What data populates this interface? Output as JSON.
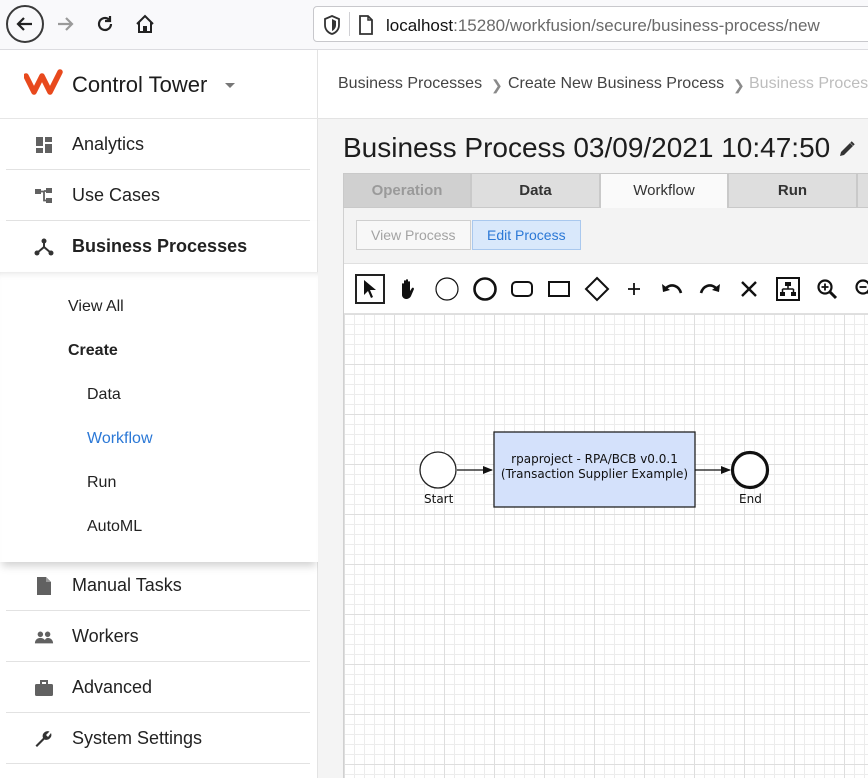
{
  "browser": {
    "url_host": "localhost",
    "url_rest": ":15280/workfusion/secure/business-process/new"
  },
  "app": {
    "name": "Control Tower",
    "accent": "#e8491d",
    "link_color": "#2b78d6"
  },
  "sidebar": {
    "items": [
      {
        "label": "Analytics",
        "icon": "dashboard-icon"
      },
      {
        "label": "Use Cases",
        "icon": "hierarchy-icon"
      },
      {
        "label": "Business Processes",
        "icon": "merge-icon",
        "active": true
      },
      {
        "label": "Manual Tasks",
        "icon": "document-icon"
      },
      {
        "label": "Workers",
        "icon": "people-icon"
      },
      {
        "label": "Advanced",
        "icon": "briefcase-icon"
      },
      {
        "label": "System Settings",
        "icon": "wrench-icon"
      }
    ],
    "submenu": {
      "view_all": "View All",
      "create": "Create",
      "children": [
        "Data",
        "Workflow",
        "Run",
        "AutoML"
      ],
      "current": "Workflow"
    }
  },
  "breadcrumb": [
    "Business Processes",
    "Create New Business Process",
    "Business Proces"
  ],
  "page": {
    "title": "Business Process 03/09/2021 10:47:50"
  },
  "tabs": [
    {
      "label": "Operation",
      "state": "disabled"
    },
    {
      "label": "Data",
      "state": "normal"
    },
    {
      "label": "Workflow",
      "state": "active"
    },
    {
      "label": "Run",
      "state": "normal"
    }
  ],
  "process_buttons": {
    "view": "View Process",
    "edit": "Edit Process"
  },
  "toolbar_icons": [
    "pointer-icon",
    "hand-icon",
    "start-event-icon",
    "end-event-icon",
    "task-icon",
    "subprocess-icon",
    "gateway-icon",
    "add-icon",
    "undo-icon",
    "redo-icon",
    "delete-icon",
    "layout-icon",
    "zoom-in-icon",
    "zoom-out-icon"
  ],
  "diagram": {
    "start_label": "Start",
    "end_label": "End",
    "task_line1": "rpaproject - RPA/BCB v0.0.1",
    "task_line2": "(Transaction Supplier Example)",
    "task_fill": "#d4e1fb"
  }
}
